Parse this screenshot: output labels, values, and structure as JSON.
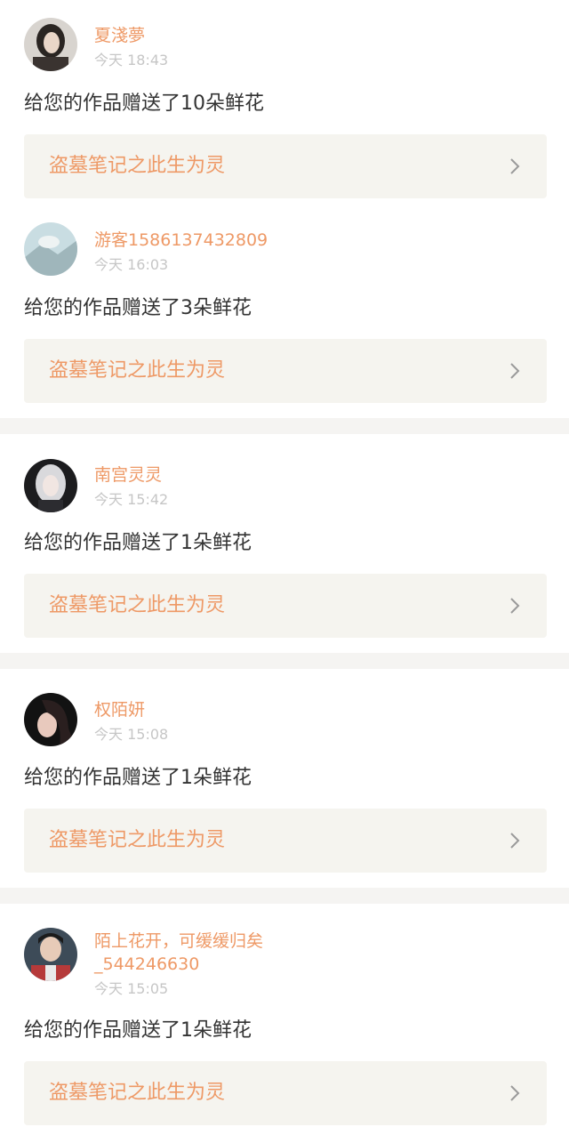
{
  "colors": {
    "accent": "#ee9966",
    "time_text": "#c6c6c6",
    "message_text": "#333333",
    "work_bg": "#f5f4ef",
    "separator": "#f5f4f2"
  },
  "items": [
    {
      "avatar_icon": "user-avatar-photo",
      "name": "夏淺夢",
      "time": "今天 18:43",
      "message": "给您的作品赠送了10朵鲜花",
      "work_title": "盗墓笔记之此生为灵"
    },
    {
      "avatar_icon": "user-avatar-photo",
      "name": "游客1586137432809",
      "time": "今天 16:03",
      "message": "给您的作品赠送了3朵鲜花",
      "work_title": "盗墓笔记之此生为灵"
    },
    {
      "avatar_icon": "user-avatar-photo",
      "name": "南宫灵灵",
      "time": "今天 15:42",
      "message": "给您的作品赠送了1朵鲜花",
      "work_title": "盗墓笔记之此生为灵"
    },
    {
      "avatar_icon": "user-avatar-photo",
      "name": "权陌妍",
      "time": "今天 15:08",
      "message": "给您的作品赠送了1朵鲜花",
      "work_title": "盗墓笔记之此生为灵"
    },
    {
      "avatar_icon": "user-avatar-photo",
      "name_line1": "陌上花开，可缓缓归矣",
      "name_line2": "_544246630",
      "time": "今天 15:05",
      "message": "给您的作品赠送了1朵鲜花",
      "work_title": "盗墓笔记之此生为灵"
    }
  ]
}
